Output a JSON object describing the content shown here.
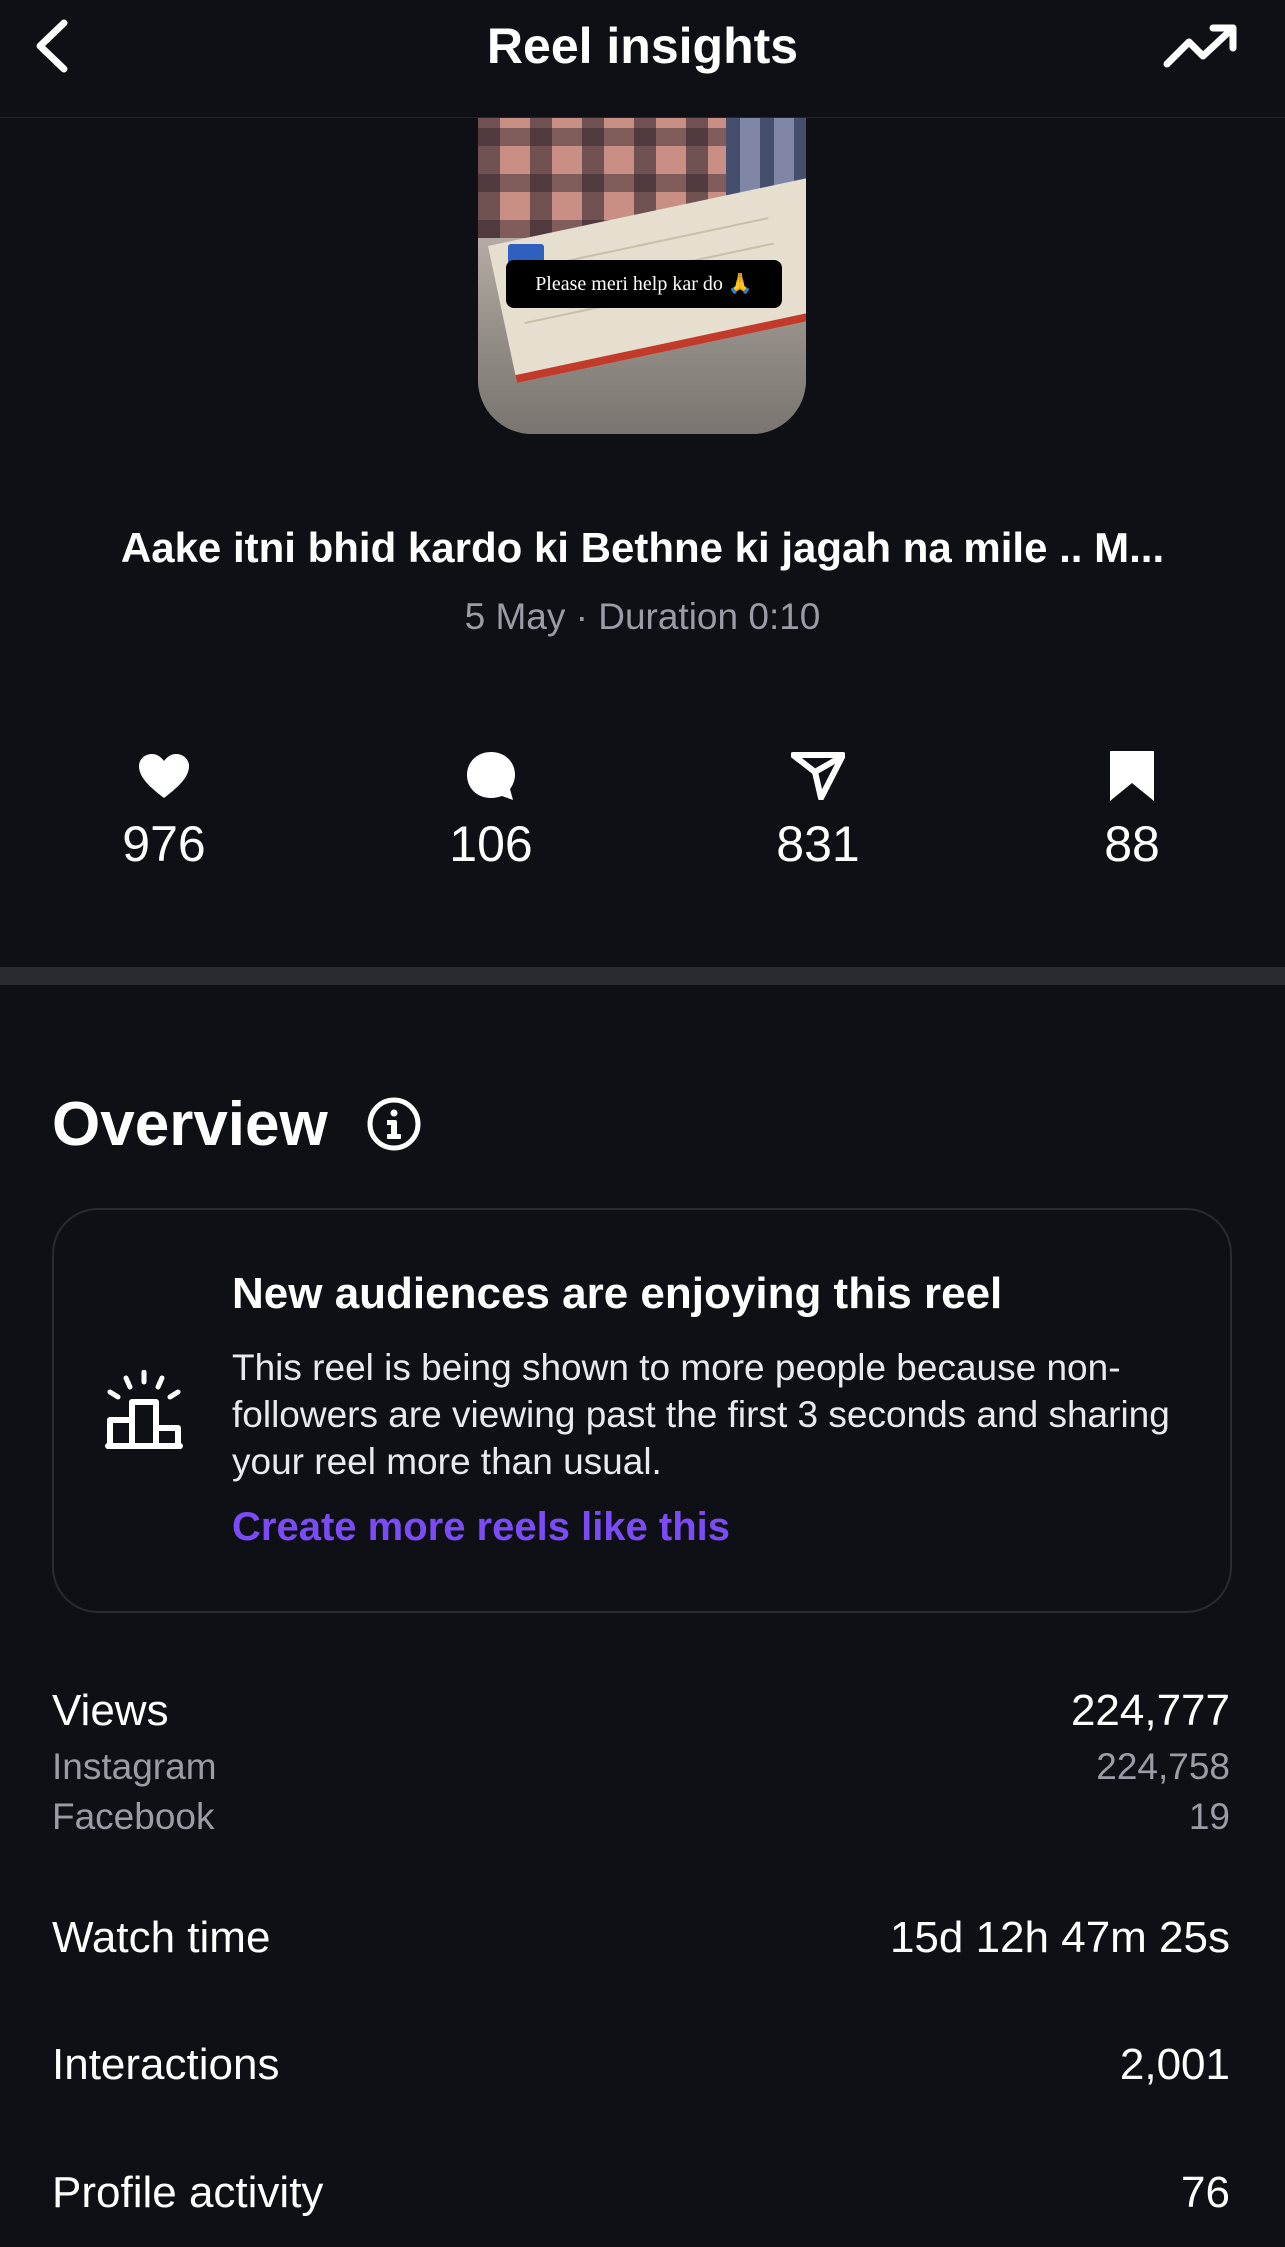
{
  "header": {
    "title": "Reel insights"
  },
  "thumbnail": {
    "caption": "Please meri help kar do 🙏"
  },
  "reel": {
    "title": "Aake itni bhid kardo ki Bethne ki jagah na mile .. M...",
    "meta": "5 May · Duration 0:10"
  },
  "stats": {
    "likes": "976",
    "comments": "106",
    "shares": "831",
    "saves": "88"
  },
  "overview": {
    "title": "Overview",
    "card": {
      "heading": "New audiences are enjoying this reel",
      "body": "This reel is being shown to more people because non-followers are viewing past the first 3 seconds and sharing your reel more than usual.",
      "link": "Create more reels like this"
    },
    "metrics": {
      "views_label": "Views",
      "views_value": "224,777",
      "instagram_label": "Instagram",
      "instagram_value": "224,758",
      "facebook_label": "Facebook",
      "facebook_value": "19",
      "watch_time_label": "Watch time",
      "watch_time_value": "15d 12h 47m 25s",
      "interactions_label": "Interactions",
      "interactions_value": "2,001",
      "profile_activity_label": "Profile activity",
      "profile_activity_value": "76"
    }
  },
  "icons": {
    "back": "chevron-left-icon",
    "trend": "trending-up-icon",
    "like": "heart-icon",
    "comment": "comment-bubble-icon",
    "share": "send-icon",
    "save": "bookmark-icon",
    "info": "info-icon",
    "audience": "podium-sparkle-icon"
  },
  "colors": {
    "background": "#0f1015",
    "accent_link": "#7b4cf6",
    "secondary_text": "#9a9ca6"
  }
}
